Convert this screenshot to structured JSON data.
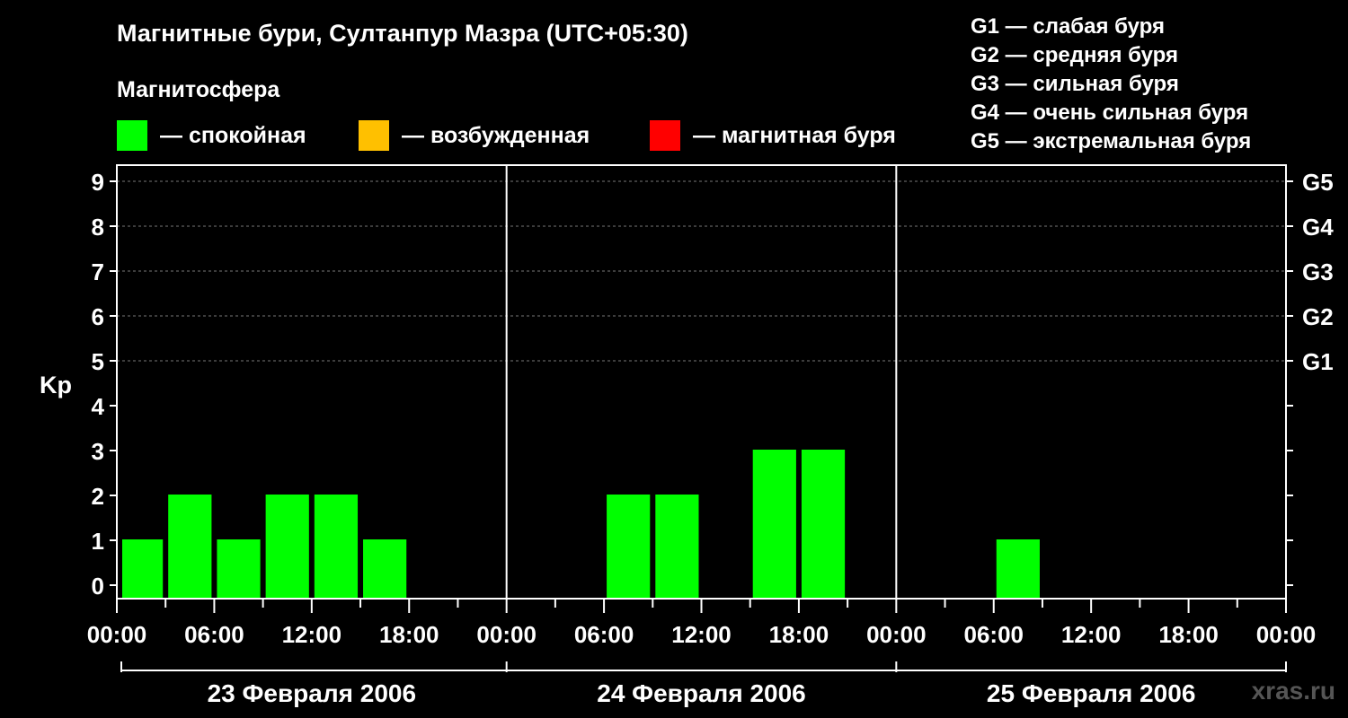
{
  "header": {
    "title": "Магнитные бури, Султанпур Мазра (UTC+05:30)",
    "subtitle": "Магнитосфера"
  },
  "legend": [
    {
      "label": "— спокойная",
      "color": "#00ff00"
    },
    {
      "label": "— возбужденная",
      "color": "#ffc000"
    },
    {
      "label": "— магнитная буря",
      "color": "#ff0000"
    }
  ],
  "storm_levels": [
    "G1 — слабая буря",
    "G2 — средняя буря",
    "G3 — сильная буря",
    "G4 — очень сильная буря",
    "G5 — экстремальная буря"
  ],
  "watermark": "xras.ru",
  "chart_data": {
    "type": "bar",
    "ylabel": "Kp",
    "ylim": [
      0,
      9
    ],
    "y_ticks": [
      "0",
      "1",
      "2",
      "3",
      "4",
      "5",
      "6",
      "7",
      "8",
      "9"
    ],
    "right_axis_labels": [
      {
        "kp": 5,
        "label": "G1"
      },
      {
        "kp": 6,
        "label": "G2"
      },
      {
        "kp": 7,
        "label": "G3"
      },
      {
        "kp": 8,
        "label": "G4"
      },
      {
        "kp": 9,
        "label": "G5"
      }
    ],
    "x_tick_labels": [
      "00:00",
      "06:00",
      "12:00",
      "18:00",
      "00:00",
      "06:00",
      "12:00",
      "18:00",
      "00:00",
      "06:00",
      "12:00",
      "18:00",
      "00:00"
    ],
    "days": [
      "23 Февраля 2006",
      "24 Февраля 2006",
      "25 Февраля 2006"
    ],
    "grid": "dashed horizontal at Kp 5–9",
    "bar_color": "#00ff00",
    "series": [
      {
        "values": [
          {
            "day": 0,
            "hour": 0,
            "kp": 1
          },
          {
            "day": 0,
            "hour": 3,
            "kp": 2
          },
          {
            "day": 0,
            "hour": 6,
            "kp": 1
          },
          {
            "day": 0,
            "hour": 9,
            "kp": 2
          },
          {
            "day": 0,
            "hour": 12,
            "kp": 2
          },
          {
            "day": 0,
            "hour": 15,
            "kp": 1
          },
          {
            "day": 1,
            "hour": 6,
            "kp": 2
          },
          {
            "day": 1,
            "hour": 9,
            "kp": 2
          },
          {
            "day": 1,
            "hour": 15,
            "kp": 3
          },
          {
            "day": 1,
            "hour": 18,
            "kp": 3
          },
          {
            "day": 2,
            "hour": 6,
            "kp": 1
          }
        ]
      }
    ]
  }
}
